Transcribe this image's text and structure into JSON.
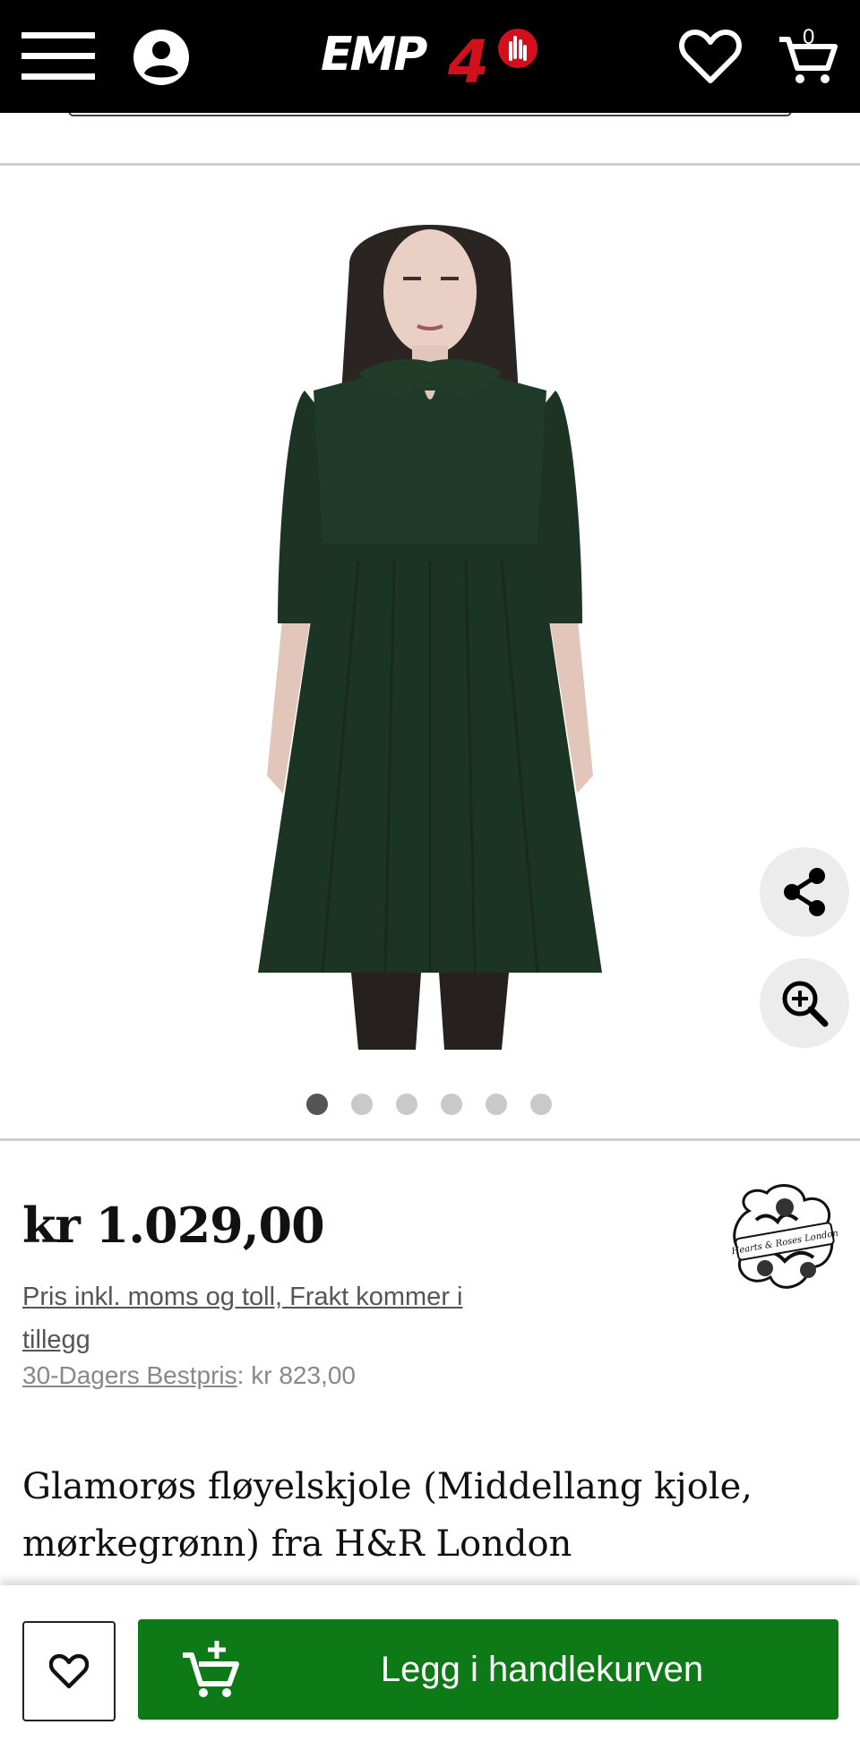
{
  "header": {
    "logo_text": "EMP40",
    "cart_count": "0",
    "icons": [
      "menu-icon",
      "account-icon",
      "wishlist-icon",
      "cart-icon"
    ]
  },
  "gallery": {
    "image_description_icon": "product-photo",
    "total_images": 6,
    "active_index": 0,
    "actions": [
      "share-icon",
      "zoom-in-icon"
    ]
  },
  "product": {
    "price": "kr 1.029,00",
    "tax_note": "Pris inkl. moms og toll, Frakt kommer i tillegg",
    "best_price_label": "30-Dagers Bestpris",
    "best_price_value": ": kr 823,00",
    "title": "Glamorøs fløyelskjole (Middellang kjole, mørkegrønn) fra H&R London",
    "brand_logo_text": "Hearts & Roses London"
  },
  "bottom_bar": {
    "add_to_cart_label": "Legg i handlekurven",
    "button_color": "#0e7a17"
  }
}
